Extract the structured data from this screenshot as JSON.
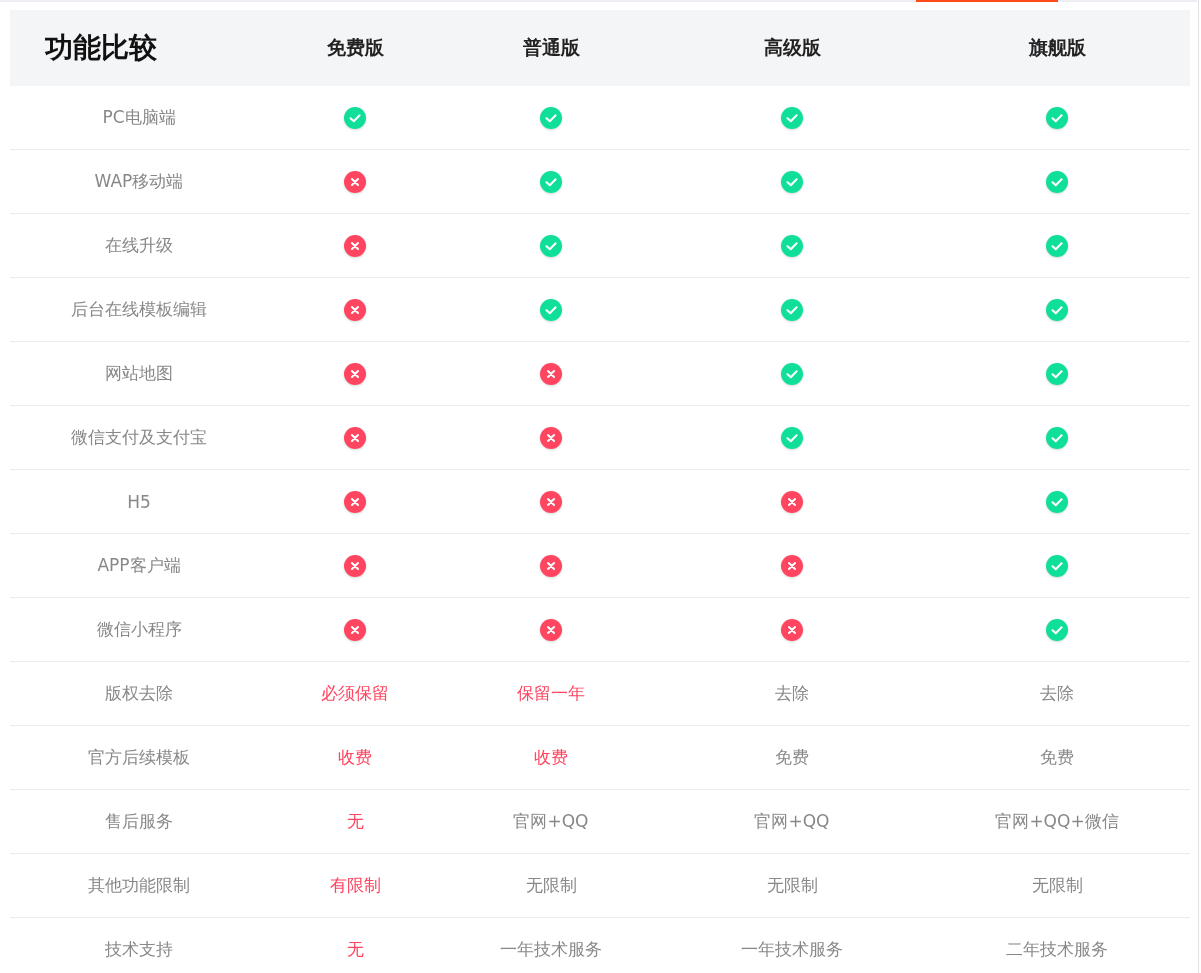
{
  "table": {
    "title": "功能比较",
    "columns": [
      "免费版",
      "普通版",
      "高级版",
      "旗舰版"
    ],
    "rows": [
      {
        "label": "PC电脑端",
        "cells": [
          {
            "kind": "mark",
            "available": true
          },
          {
            "kind": "mark",
            "available": true
          },
          {
            "kind": "mark",
            "available": true
          },
          {
            "kind": "mark",
            "available": true
          }
        ]
      },
      {
        "label": "WAP移动端",
        "cells": [
          {
            "kind": "mark",
            "available": false
          },
          {
            "kind": "mark",
            "available": true
          },
          {
            "kind": "mark",
            "available": true
          },
          {
            "kind": "mark",
            "available": true
          }
        ]
      },
      {
        "label": "在线升级",
        "cells": [
          {
            "kind": "mark",
            "available": false
          },
          {
            "kind": "mark",
            "available": true
          },
          {
            "kind": "mark",
            "available": true
          },
          {
            "kind": "mark",
            "available": true
          }
        ]
      },
      {
        "label": "后台在线模板编辑",
        "cells": [
          {
            "kind": "mark",
            "available": false
          },
          {
            "kind": "mark",
            "available": true
          },
          {
            "kind": "mark",
            "available": true
          },
          {
            "kind": "mark",
            "available": true
          }
        ]
      },
      {
        "label": "网站地图",
        "cells": [
          {
            "kind": "mark",
            "available": false
          },
          {
            "kind": "mark",
            "available": false
          },
          {
            "kind": "mark",
            "available": true
          },
          {
            "kind": "mark",
            "available": true
          }
        ]
      },
      {
        "label": "微信支付及支付宝",
        "cells": [
          {
            "kind": "mark",
            "available": false
          },
          {
            "kind": "mark",
            "available": false
          },
          {
            "kind": "mark",
            "available": true
          },
          {
            "kind": "mark",
            "available": true
          }
        ]
      },
      {
        "label": "H5",
        "cells": [
          {
            "kind": "mark",
            "available": false
          },
          {
            "kind": "mark",
            "available": false
          },
          {
            "kind": "mark",
            "available": false
          },
          {
            "kind": "mark",
            "available": true
          }
        ]
      },
      {
        "label": "APP客户端",
        "cells": [
          {
            "kind": "mark",
            "available": false
          },
          {
            "kind": "mark",
            "available": false
          },
          {
            "kind": "mark",
            "available": false
          },
          {
            "kind": "mark",
            "available": true
          }
        ]
      },
      {
        "label": "微信小程序",
        "cells": [
          {
            "kind": "mark",
            "available": false
          },
          {
            "kind": "mark",
            "available": false
          },
          {
            "kind": "mark",
            "available": false
          },
          {
            "kind": "mark",
            "available": true
          }
        ]
      },
      {
        "label": "版权去除",
        "cells": [
          {
            "kind": "text",
            "text": "必须保留",
            "warning": true
          },
          {
            "kind": "text",
            "text": "保留一年",
            "warning": true
          },
          {
            "kind": "text",
            "text": "去除",
            "warning": false
          },
          {
            "kind": "text",
            "text": "去除",
            "warning": false
          }
        ]
      },
      {
        "label": "官方后续模板",
        "cells": [
          {
            "kind": "text",
            "text": "收费",
            "warning": true
          },
          {
            "kind": "text",
            "text": "收费",
            "warning": true
          },
          {
            "kind": "text",
            "text": "免费",
            "warning": false
          },
          {
            "kind": "text",
            "text": "免费",
            "warning": false
          }
        ]
      },
      {
        "label": "售后服务",
        "cells": [
          {
            "kind": "text",
            "text": "无",
            "warning": true
          },
          {
            "kind": "text",
            "text": "官网+QQ",
            "warning": false
          },
          {
            "kind": "text",
            "text": "官网+QQ",
            "warning": false
          },
          {
            "kind": "text",
            "text": "官网+QQ+微信",
            "warning": false
          }
        ]
      },
      {
        "label": "其他功能限制",
        "cells": [
          {
            "kind": "text",
            "text": "有限制",
            "warning": true
          },
          {
            "kind": "text",
            "text": "无限制",
            "warning": false
          },
          {
            "kind": "text",
            "text": "无限制",
            "warning": false
          },
          {
            "kind": "text",
            "text": "无限制",
            "warning": false
          }
        ]
      },
      {
        "label": "技术支持",
        "cells": [
          {
            "kind": "text",
            "text": "无",
            "warning": true
          },
          {
            "kind": "text",
            "text": "一年技术服务",
            "warning": false
          },
          {
            "kind": "text",
            "text": "一年技术服务",
            "warning": false
          },
          {
            "kind": "text",
            "text": "二年技术服务",
            "warning": false
          }
        ]
      }
    ]
  }
}
